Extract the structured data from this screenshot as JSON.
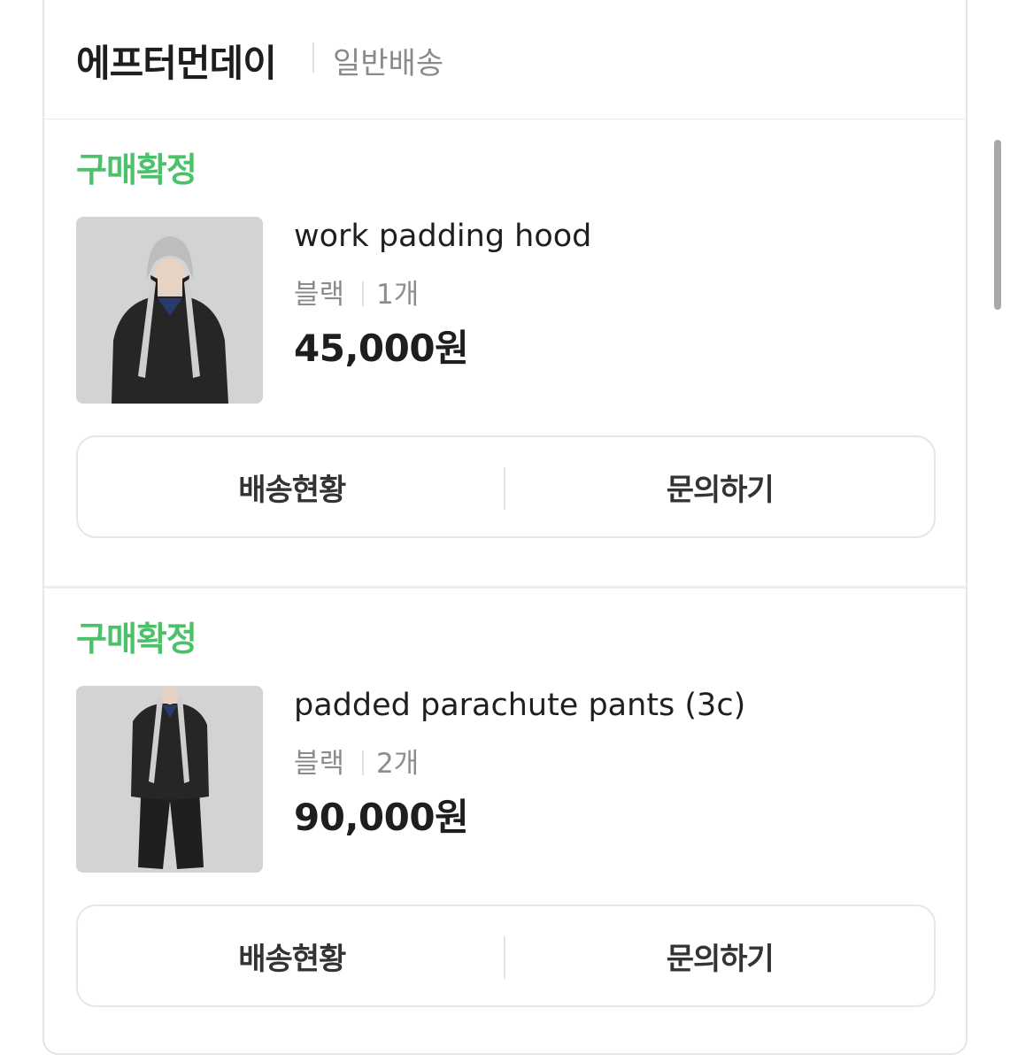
{
  "seller": {
    "name": "에프터먼데이",
    "shipping_type": "일반배송"
  },
  "orders": [
    {
      "status": "구매확정",
      "status_color": "#4cc16a",
      "product_name": "work padding hood",
      "option": "블랙",
      "quantity": "1개",
      "price": "45,000원",
      "thumbnail": "product-photo-hood",
      "buttons": {
        "track": "배송현황",
        "inquiry": "문의하기"
      }
    },
    {
      "status": "구매확정",
      "status_color": "#4cc16a",
      "product_name": "padded parachute pants (3c)",
      "option": "블랙",
      "quantity": "2개",
      "price": "90,000원",
      "thumbnail": "product-photo-pants",
      "buttons": {
        "track": "배송현황",
        "inquiry": "문의하기"
      }
    }
  ]
}
